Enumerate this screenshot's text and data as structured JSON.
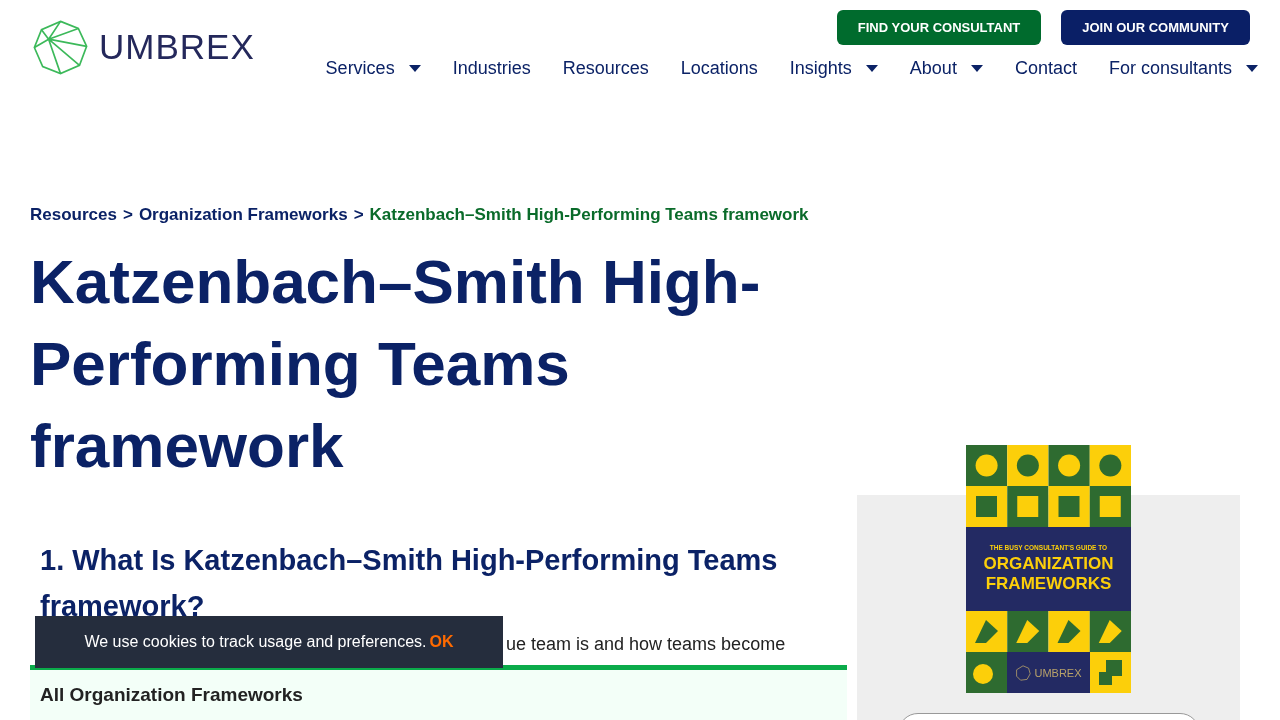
{
  "header": {
    "logo_text": "UMBREX",
    "buttons": [
      {
        "label": "FIND YOUR CONSULTANT",
        "kind": "primary"
      },
      {
        "label": "JOIN OUR COMMUNITY",
        "kind": "secondary"
      }
    ],
    "nav": [
      {
        "label": "Services",
        "has_menu": true
      },
      {
        "label": "Industries",
        "has_menu": false
      },
      {
        "label": "Resources",
        "has_menu": false
      },
      {
        "label": "Locations",
        "has_menu": false
      },
      {
        "label": "Insights",
        "has_menu": true
      },
      {
        "label": "About",
        "has_menu": true
      },
      {
        "label": "Contact",
        "has_menu": false
      },
      {
        "label": "For consultants",
        "has_menu": true
      }
    ]
  },
  "breadcrumb": {
    "links": [
      "Resources",
      "Organization Frameworks"
    ],
    "separator": ">",
    "current": "Katzenbach–Smith High-Performing Teams framework"
  },
  "title": "Katzenbach–Smith High-Performing Teams framework",
  "section_heading": "1. What Is Katzenbach–Smith High-Performing Teams framework?",
  "body_fragment": "ue team is and how teams become",
  "frameworks_bar": {
    "label": "All Organization Frameworks"
  },
  "cookie_banner": {
    "text": "We use cookies to track usage and preferences.",
    "button": "OK"
  },
  "book_cover": {
    "subtitle": "THE BUSY CONSULTANT'S GUIDE TO",
    "title_lines": [
      "ORGANIZATION",
      "FRAMEWORKS"
    ],
    "brand": "UMBREX"
  }
}
